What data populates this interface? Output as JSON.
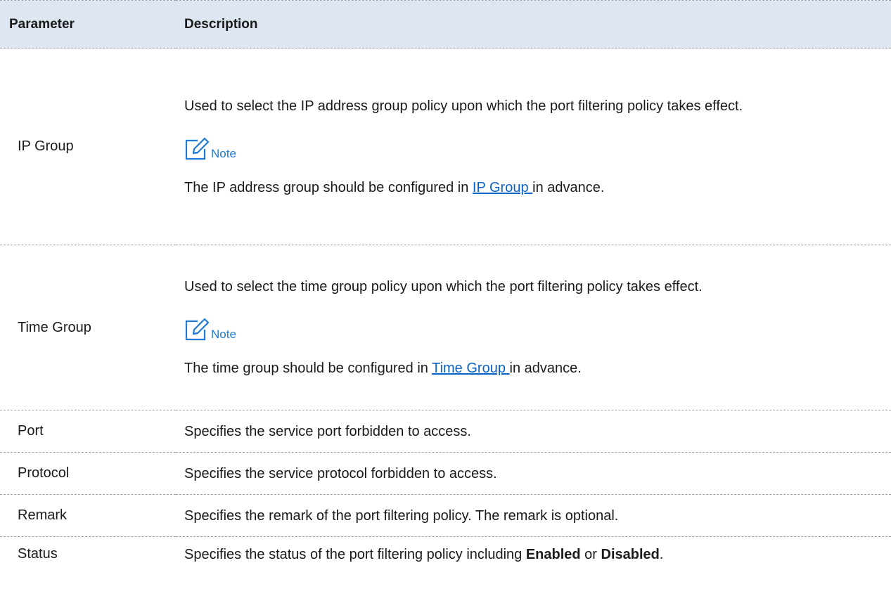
{
  "header": {
    "parameter": "Parameter",
    "description": "Description"
  },
  "note_label": "Note",
  "colors": {
    "header_bg": "#dde6f1",
    "accent": "#1f79d6",
    "link": "#0b62c4"
  },
  "rows": {
    "ip_group": {
      "name": "IP Group",
      "text": "Used to select the IP address group policy upon which the port filtering policy takes effect.",
      "note_before": "The IP address group should be configured in ",
      "note_link": "IP Group ",
      "note_after": "in advance."
    },
    "time_group": {
      "name": "Time Group",
      "text": "Used to select the time group policy upon which the port filtering policy takes effect.",
      "note_before": "The time group should be configured in ",
      "note_link": "Time Group ",
      "note_after": "in advance."
    },
    "port": {
      "name": "Port",
      "text": "Specifies the service port forbidden to access."
    },
    "protocol": {
      "name": "Protocol",
      "text": "Specifies the service protocol forbidden to access."
    },
    "remark": {
      "name": "Remark",
      "text": "Specifies the remark of the port filtering policy. The remark is optional."
    },
    "status": {
      "name": "Status",
      "text_before": "Specifies the status of the port filtering policy including ",
      "bold1": "Enabled",
      "mid": " or ",
      "bold2": "Disabled",
      "end": "."
    }
  }
}
